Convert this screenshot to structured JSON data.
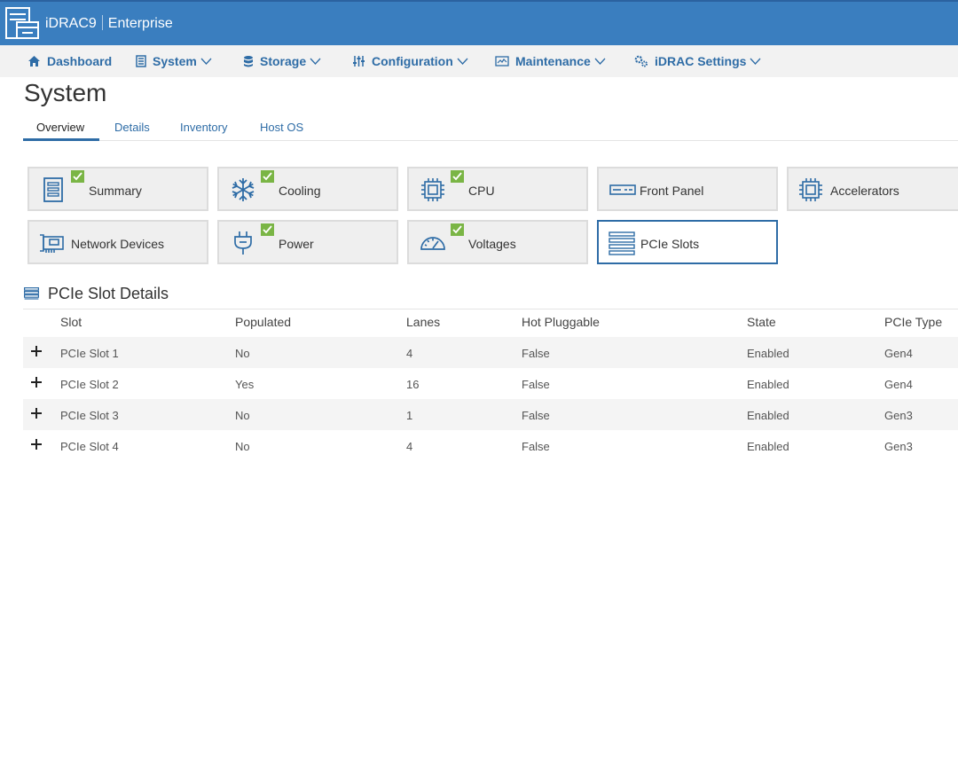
{
  "header": {
    "app_name": "iDRAC9",
    "edition": "Enterprise"
  },
  "nav": {
    "items": [
      {
        "label": "Dashboard",
        "icon": "home-icon",
        "has_dropdown": false
      },
      {
        "label": "System",
        "icon": "server-icon",
        "has_dropdown": true
      },
      {
        "label": "Storage",
        "icon": "database-icon",
        "has_dropdown": true
      },
      {
        "label": "Configuration",
        "icon": "sliders-icon",
        "has_dropdown": true
      },
      {
        "label": "Maintenance",
        "icon": "monitor-icon",
        "has_dropdown": true
      },
      {
        "label": "iDRAC Settings",
        "icon": "gears-icon",
        "has_dropdown": true
      }
    ]
  },
  "page": {
    "title": "System"
  },
  "tabs": [
    {
      "label": "Overview",
      "active": true
    },
    {
      "label": "Details",
      "active": false
    },
    {
      "label": "Inventory",
      "active": false
    },
    {
      "label": "Host OS",
      "active": false
    }
  ],
  "tiles": [
    {
      "label": "Summary",
      "icon": "server-icon",
      "status_ok": true,
      "selected": false
    },
    {
      "label": "Cooling",
      "icon": "snowflake-icon",
      "status_ok": true,
      "selected": false
    },
    {
      "label": "CPU",
      "icon": "cpu-chip-icon",
      "status_ok": true,
      "selected": false
    },
    {
      "label": "Front Panel",
      "icon": "front-panel-icon",
      "status_ok": false,
      "selected": false
    },
    {
      "label": "Accelerators",
      "icon": "accelerator-chip-icon",
      "status_ok": false,
      "selected": false
    },
    {
      "label": "Network Devices",
      "icon": "network-card-icon",
      "status_ok": false,
      "selected": false
    },
    {
      "label": "Power",
      "icon": "power-plug-icon",
      "status_ok": true,
      "selected": false
    },
    {
      "label": "Voltages",
      "icon": "gauge-icon",
      "status_ok": true,
      "selected": false
    },
    {
      "label": "PCIe Slots",
      "icon": "pcie-slots-icon",
      "status_ok": false,
      "selected": true
    }
  ],
  "section": {
    "title": "PCIe Slot Details"
  },
  "table": {
    "columns": [
      "Slot",
      "Populated",
      "Lanes",
      "Hot Pluggable",
      "State",
      "PCIe Type"
    ],
    "rows": [
      [
        "PCIe Slot 1",
        "No",
        "4",
        "False",
        "Enabled",
        "Gen4"
      ],
      [
        "PCIe Slot 2",
        "Yes",
        "16",
        "False",
        "Enabled",
        "Gen4"
      ],
      [
        "PCIe Slot 3",
        "No",
        "1",
        "False",
        "Enabled",
        "Gen3"
      ],
      [
        "PCIe Slot 4",
        "No",
        "4",
        "False",
        "Enabled",
        "Gen3"
      ]
    ]
  },
  "colors": {
    "header_bg": "#3a7ebf",
    "accent": "#2e6ca6",
    "ok_green": "#7ab545"
  }
}
